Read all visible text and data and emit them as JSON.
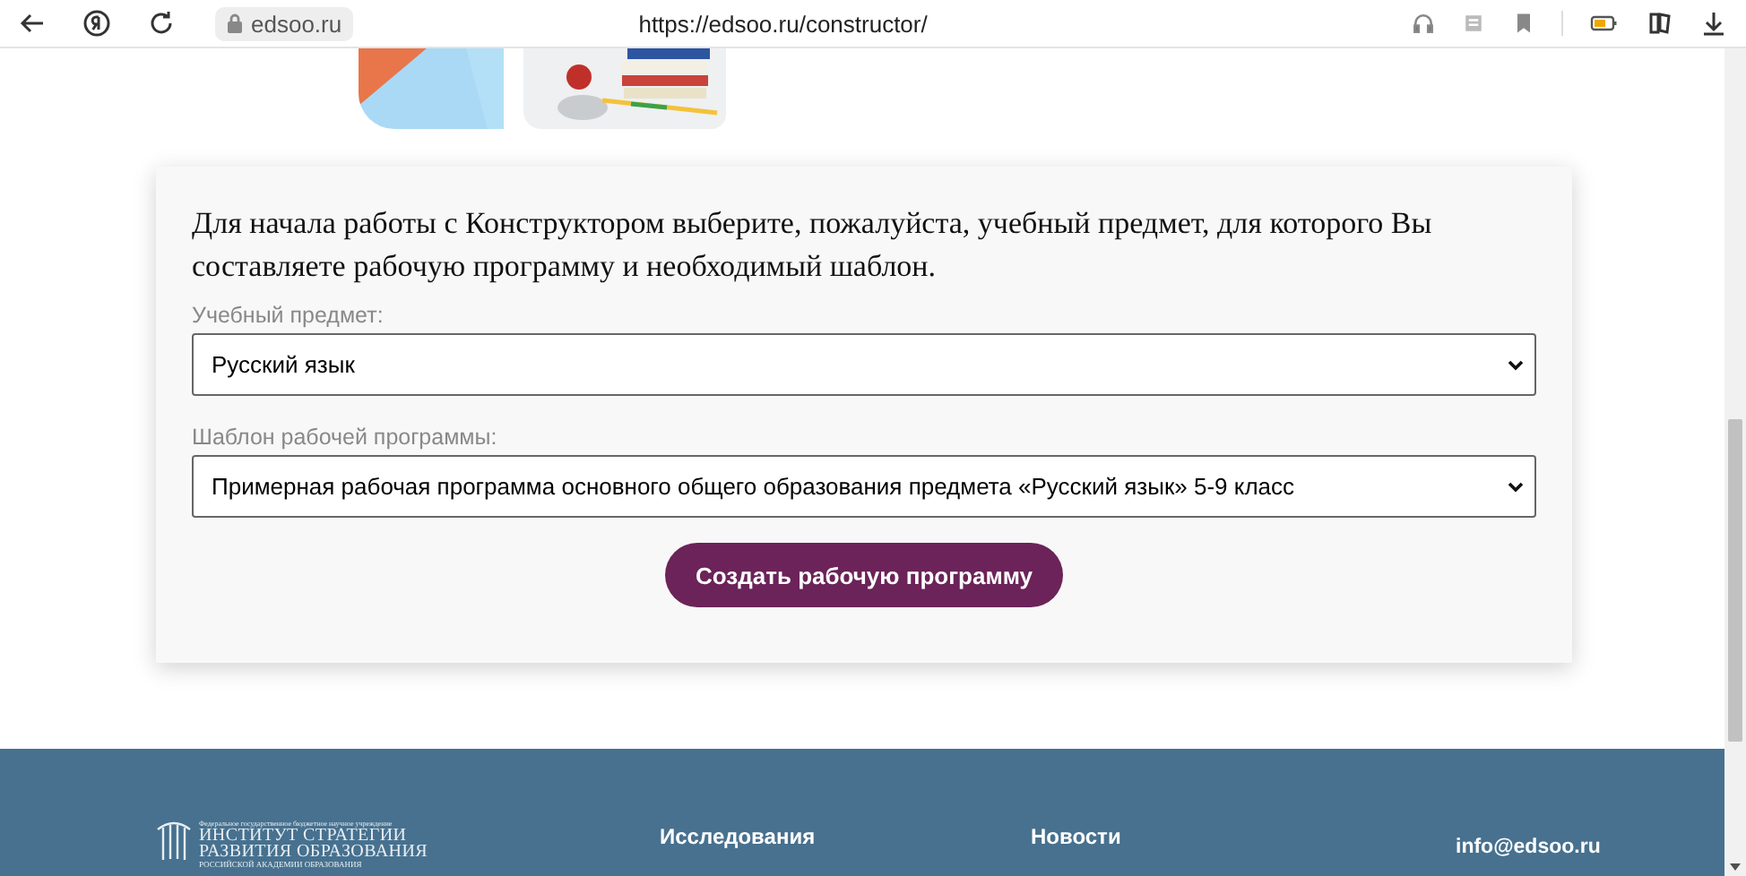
{
  "browser": {
    "domain": "edsoo.ru",
    "url": "https://edsoo.ru/constructor/"
  },
  "form": {
    "intro": "Для начала работы с Конструктором выберите, пожалуйста, учебный предмет, для которого Вы составляете рабочую программу и необходимый шаблон.",
    "fields": [
      {
        "label": "Учебный предмет:",
        "value": "Русский язык"
      },
      {
        "label": "Шаблон рабочей программы:",
        "value": "Примерная рабочая программа основного общего образования предмета «Русский язык» 5-9 класс"
      }
    ],
    "submit": "Создать рабочую программу"
  },
  "footer": {
    "logo": {
      "caption_top": "Федеральное государственное бюджетное научное учреждение",
      "name_lines": [
        "ИНСТИТУТ СТРАТЕГИИ",
        "РАЗВИТИЯ ОБРАЗОВАНИЯ"
      ],
      "caption_bottom": "РОССИЙСКОЙ АКАДЕМИИ ОБРАЗОВАНИЯ"
    },
    "links": [
      "Исследования",
      "Новости"
    ],
    "email": "info@edsoo.ru"
  }
}
